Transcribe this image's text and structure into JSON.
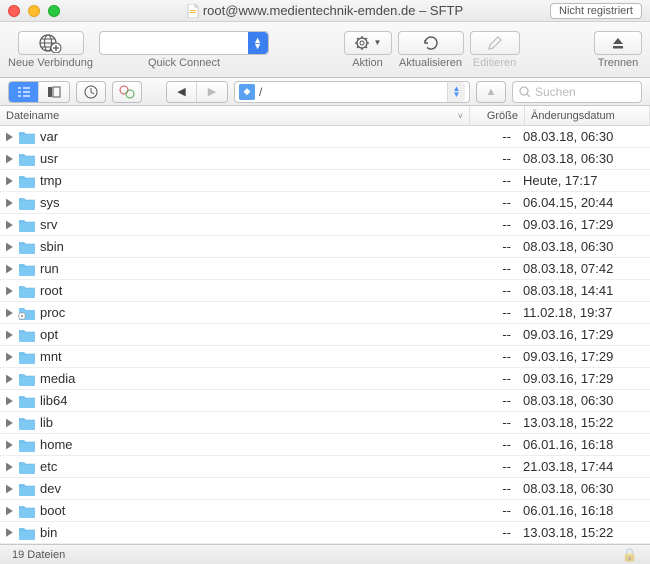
{
  "window": {
    "title": "root@www.medientechnik-emden.de – SFTP",
    "unregistered": "Nicht registriert"
  },
  "toolbar": {
    "new_connection": "Neue Verbindung",
    "quick_connect": "Quick Connect",
    "action": "Aktion",
    "refresh": "Aktualisieren",
    "edit": "Editieren",
    "disconnect": "Trennen"
  },
  "nav": {
    "path": "/",
    "search_placeholder": "Suchen"
  },
  "columns": {
    "name": "Dateiname",
    "size": "Größe",
    "date": "Änderungsdatum"
  },
  "files": [
    {
      "name": "var",
      "size": "--",
      "date": "08.03.18, 06:30"
    },
    {
      "name": "usr",
      "size": "--",
      "date": "08.03.18, 06:30"
    },
    {
      "name": "tmp",
      "size": "--",
      "date": "Heute, 17:17"
    },
    {
      "name": "sys",
      "size": "--",
      "date": "06.04.15, 20:44"
    },
    {
      "name": "srv",
      "size": "--",
      "date": "09.03.16, 17:29"
    },
    {
      "name": "sbin",
      "size": "--",
      "date": "08.03.18, 06:30"
    },
    {
      "name": "run",
      "size": "--",
      "date": "08.03.18, 07:42"
    },
    {
      "name": "root",
      "size": "--",
      "date": "08.03.18, 14:41"
    },
    {
      "name": "proc",
      "size": "--",
      "date": "11.02.18, 19:37"
    },
    {
      "name": "opt",
      "size": "--",
      "date": "09.03.16, 17:29"
    },
    {
      "name": "mnt",
      "size": "--",
      "date": "09.03.16, 17:29"
    },
    {
      "name": "media",
      "size": "--",
      "date": "09.03.16, 17:29"
    },
    {
      "name": "lib64",
      "size": "--",
      "date": "08.03.18, 06:30"
    },
    {
      "name": "lib",
      "size": "--",
      "date": "13.03.18, 15:22"
    },
    {
      "name": "home",
      "size": "--",
      "date": "06.01.16, 16:18"
    },
    {
      "name": "etc",
      "size": "--",
      "date": "21.03.18, 17:44"
    },
    {
      "name": "dev",
      "size": "--",
      "date": "08.03.18, 06:30"
    },
    {
      "name": "boot",
      "size": "--",
      "date": "06.01.16, 16:18"
    },
    {
      "name": "bin",
      "size": "--",
      "date": "13.03.18, 15:22"
    }
  ],
  "status": {
    "count": "19 Dateien"
  }
}
